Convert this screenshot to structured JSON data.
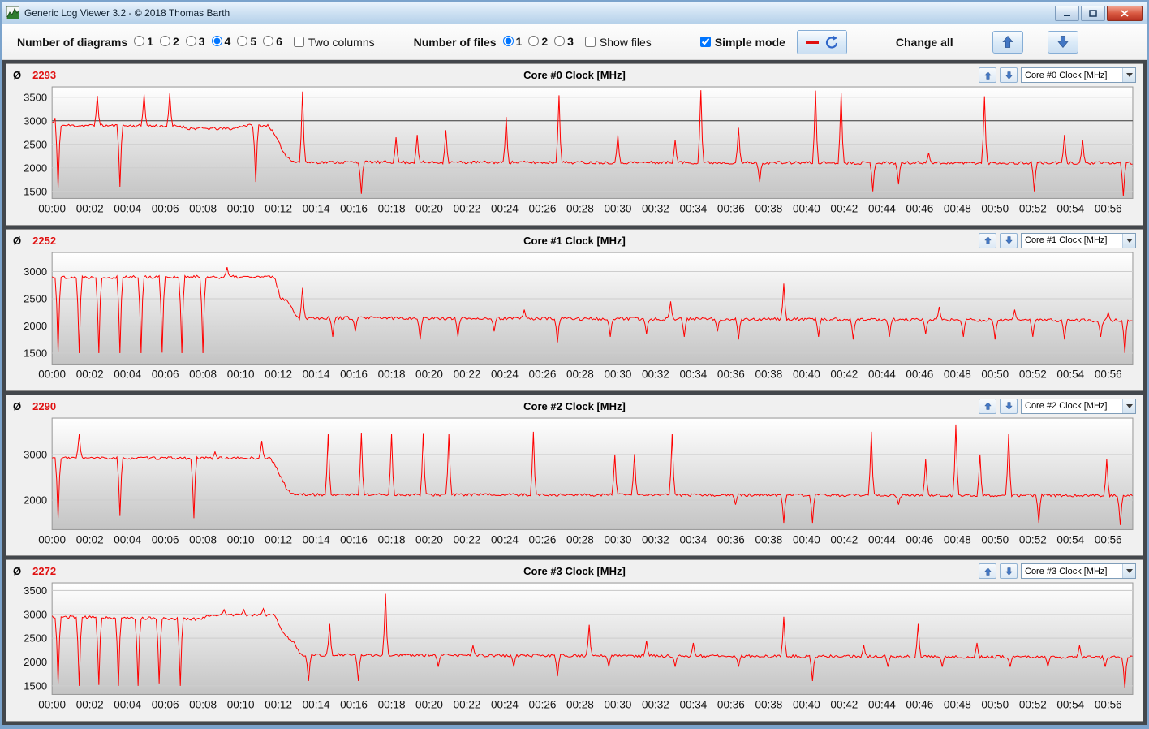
{
  "window": {
    "title": "Generic Log Viewer 3.2 - © 2018 Thomas Barth"
  },
  "toolbar": {
    "diagrams_label": "Number of diagrams",
    "diagram_options": [
      "1",
      "2",
      "3",
      "4",
      "5",
      "6"
    ],
    "diagrams_selected": "4",
    "two_columns_label": "Two columns",
    "two_columns_checked": false,
    "files_label": "Number of files",
    "file_options": [
      "1",
      "2",
      "3"
    ],
    "files_selected": "1",
    "show_files_label": "Show files",
    "show_files_checked": false,
    "simple_mode_label": "Simple mode",
    "simple_mode_checked": true,
    "change_all_label": "Change all"
  },
  "panel_chrome": {
    "avg_symbol": "Ø"
  },
  "chart_data": [
    {
      "type": "line",
      "title": "Core #0 Clock [MHz]",
      "average": 2293,
      "color": "#ff0000",
      "x_range": [
        0,
        57.3
      ],
      "ylim": [
        1350,
        3720
      ],
      "yticks": [
        1500,
        2000,
        2500,
        3000,
        3500
      ],
      "emphasis_line": 3000,
      "xticks": {
        "minutes": [
          0,
          2,
          4,
          6,
          8,
          10,
          12,
          14,
          16,
          18,
          20,
          22,
          24,
          26,
          28,
          30,
          32,
          34,
          36,
          38,
          40,
          42,
          44,
          46,
          48,
          50,
          52,
          54,
          56
        ],
        "labels": [
          "00:00",
          "00:02",
          "00:04",
          "00:06",
          "00:08",
          "00:10",
          "00:12",
          "00:14",
          "00:16",
          "00:18",
          "00:20",
          "00:22",
          "00:24",
          "00:26",
          "00:28",
          "00:30",
          "00:32",
          "00:34",
          "00:36",
          "00:38",
          "00:40",
          "00:42",
          "00:44",
          "00:46",
          "00:48",
          "00:50",
          "00:52",
          "00:54",
          "00:56"
        ]
      },
      "baseline": [
        [
          0,
          2950
        ],
        [
          0.6,
          2900
        ],
        [
          6.8,
          2890
        ],
        [
          7.2,
          2840
        ],
        [
          9.6,
          2830
        ],
        [
          10.1,
          2900
        ],
        [
          11.5,
          2900
        ],
        [
          11.9,
          2620
        ],
        [
          12.4,
          2250
        ],
        [
          12.9,
          2120
        ],
        [
          57.3,
          2100
        ]
      ],
      "noise": 32,
      "seed": 11,
      "spikes": [
        [
          0.15,
          3060
        ],
        [
          2.4,
          3530
        ],
        [
          4.9,
          3560
        ],
        [
          6.2,
          3580
        ],
        [
          13.3,
          3620
        ],
        [
          18.2,
          2650
        ],
        [
          19.4,
          2700
        ],
        [
          20.9,
          2800
        ],
        [
          24.1,
          3080
        ],
        [
          26.9,
          3540
        ],
        [
          30.0,
          2700
        ],
        [
          33.0,
          2600
        ],
        [
          34.4,
          3650
        ],
        [
          36.4,
          2850
        ],
        [
          40.5,
          3640
        ],
        [
          41.8,
          3600
        ],
        [
          46.5,
          2320
        ],
        [
          49.4,
          3520
        ],
        [
          53.7,
          2700
        ],
        [
          54.6,
          2600
        ]
      ],
      "dips": [
        [
          0.35,
          1580
        ],
        [
          3.6,
          1600
        ],
        [
          10.8,
          1700
        ],
        [
          16.4,
          1450
        ],
        [
          37.5,
          1700
        ],
        [
          43.5,
          1500
        ],
        [
          44.9,
          1650
        ],
        [
          52.1,
          1500
        ],
        [
          56.8,
          1400
        ]
      ]
    },
    {
      "type": "line",
      "title": "Core #1 Clock [MHz]",
      "average": 2252,
      "color": "#ff0000",
      "x_range": [
        0,
        57.3
      ],
      "ylim": [
        1300,
        3350
      ],
      "yticks": [
        1500,
        2000,
        2500,
        3000
      ],
      "xticks": {
        "minutes": [
          0,
          2,
          4,
          6,
          8,
          10,
          12,
          14,
          16,
          18,
          20,
          22,
          24,
          26,
          28,
          30,
          32,
          34,
          36,
          38,
          40,
          42,
          44,
          46,
          48,
          50,
          52,
          54,
          56
        ],
        "labels": [
          "00:00",
          "00:02",
          "00:04",
          "00:06",
          "00:08",
          "00:10",
          "00:12",
          "00:14",
          "00:16",
          "00:18",
          "00:20",
          "00:22",
          "00:24",
          "00:26",
          "00:28",
          "00:30",
          "00:32",
          "00:34",
          "00:36",
          "00:38",
          "00:40",
          "00:42",
          "00:44",
          "00:46",
          "00:48",
          "00:50",
          "00:52",
          "00:54",
          "00:56"
        ]
      },
      "baseline": [
        [
          0,
          2900
        ],
        [
          11.8,
          2900
        ],
        [
          12.1,
          2520
        ],
        [
          12.6,
          2430
        ],
        [
          13.0,
          2150
        ],
        [
          57.3,
          2100
        ]
      ],
      "noise": 30,
      "seed": 22,
      "spikes": [
        [
          9.3,
          3080
        ],
        [
          13.3,
          2700
        ],
        [
          25.0,
          2300
        ],
        [
          32.8,
          2450
        ],
        [
          38.8,
          2780
        ],
        [
          47.0,
          2350
        ],
        [
          51.0,
          2300
        ],
        [
          56.0,
          2250
        ]
      ],
      "dips": [
        [
          0.3,
          1520
        ],
        [
          1.4,
          1500
        ],
        [
          2.5,
          1500
        ],
        [
          3.6,
          1500
        ],
        [
          4.7,
          1500
        ],
        [
          5.8,
          1510
        ],
        [
          6.9,
          1500
        ],
        [
          8.0,
          1500
        ],
        [
          14.9,
          1800
        ],
        [
          16.1,
          1900
        ],
        [
          19.5,
          1750
        ],
        [
          21.5,
          1800
        ],
        [
          23.4,
          1900
        ],
        [
          26.8,
          1700
        ],
        [
          29.6,
          1800
        ],
        [
          31.5,
          1850
        ],
        [
          33.5,
          1800
        ],
        [
          35.3,
          1900
        ],
        [
          36.4,
          1750
        ],
        [
          40.6,
          1800
        ],
        [
          42.5,
          1750
        ],
        [
          44.4,
          1800
        ],
        [
          46.3,
          1850
        ],
        [
          48.3,
          1800
        ],
        [
          50.0,
          1750
        ],
        [
          52.0,
          1800
        ],
        [
          53.7,
          1750
        ],
        [
          55.6,
          1800
        ],
        [
          56.9,
          1500
        ]
      ]
    },
    {
      "type": "line",
      "title": "Core #2 Clock [MHz]",
      "average": 2290,
      "color": "#ff0000",
      "x_range": [
        0,
        57.3
      ],
      "ylim": [
        1350,
        3800
      ],
      "yticks": [
        2000,
        3000
      ],
      "xticks": {
        "minutes": [
          0,
          2,
          4,
          6,
          8,
          10,
          12,
          14,
          16,
          18,
          20,
          22,
          24,
          26,
          28,
          30,
          32,
          34,
          36,
          38,
          40,
          42,
          44,
          46,
          48,
          50,
          52,
          54,
          56
        ],
        "labels": [
          "00:00",
          "00:02",
          "00:04",
          "00:06",
          "00:08",
          "00:10",
          "00:12",
          "00:14",
          "00:16",
          "00:18",
          "00:20",
          "00:22",
          "00:24",
          "00:26",
          "00:28",
          "00:30",
          "00:32",
          "00:34",
          "00:36",
          "00:38",
          "00:40",
          "00:42",
          "00:44",
          "00:46",
          "00:48",
          "00:50",
          "00:52",
          "00:54",
          "00:56"
        ]
      },
      "baseline": [
        [
          0,
          2920
        ],
        [
          11.6,
          2920
        ],
        [
          12.0,
          2620
        ],
        [
          12.5,
          2200
        ],
        [
          12.9,
          2120
        ],
        [
          57.3,
          2100
        ]
      ],
      "noise": 30,
      "seed": 33,
      "spikes": [
        [
          1.4,
          3450
        ],
        [
          8.6,
          3060
        ],
        [
          11.1,
          3300
        ],
        [
          14.6,
          3450
        ],
        [
          16.4,
          3480
        ],
        [
          18.0,
          3460
        ],
        [
          19.7,
          3470
        ],
        [
          21.0,
          3450
        ],
        [
          25.5,
          3500
        ],
        [
          29.8,
          3000
        ],
        [
          30.9,
          3010
        ],
        [
          32.9,
          3460
        ],
        [
          43.4,
          3500
        ],
        [
          46.3,
          2900
        ],
        [
          47.9,
          3660
        ],
        [
          49.2,
          3000
        ],
        [
          50.7,
          3450
        ],
        [
          55.9,
          2900
        ]
      ],
      "dips": [
        [
          0.3,
          1600
        ],
        [
          3.6,
          1650
        ],
        [
          7.5,
          1600
        ],
        [
          36.2,
          1900
        ],
        [
          38.8,
          1500
        ],
        [
          40.3,
          1500
        ],
        [
          44.9,
          1900
        ],
        [
          52.3,
          1500
        ],
        [
          56.6,
          1450
        ]
      ]
    },
    {
      "type": "line",
      "title": "Core #3 Clock [MHz]",
      "average": 2272,
      "color": "#ff0000",
      "x_range": [
        0,
        57.3
      ],
      "ylim": [
        1320,
        3660
      ],
      "yticks": [
        1500,
        2000,
        2500,
        3000,
        3500
      ],
      "xticks": {
        "minutes": [
          0,
          2,
          4,
          6,
          8,
          10,
          12,
          14,
          16,
          18,
          20,
          22,
          24,
          26,
          28,
          30,
          32,
          34,
          36,
          38,
          40,
          42,
          44,
          46,
          48,
          50,
          52,
          54,
          56
        ],
        "labels": [
          "00:00",
          "00:02",
          "00:04",
          "00:06",
          "00:08",
          "00:10",
          "00:12",
          "00:14",
          "00:16",
          "00:18",
          "00:20",
          "00:22",
          "00:24",
          "00:26",
          "00:28",
          "00:30",
          "00:32",
          "00:34",
          "00:36",
          "00:38",
          "00:40",
          "00:42",
          "00:44",
          "00:46",
          "00:48",
          "00:50",
          "00:52",
          "00:54",
          "00:56"
        ]
      },
      "baseline": [
        [
          0,
          2950
        ],
        [
          7.8,
          2900
        ],
        [
          8.4,
          2990
        ],
        [
          11.8,
          2990
        ],
        [
          12.2,
          2620
        ],
        [
          12.8,
          2420
        ],
        [
          13.2,
          2150
        ],
        [
          57.3,
          2100
        ]
      ],
      "noise": 30,
      "seed": 44,
      "spikes": [
        [
          9.1,
          3100
        ],
        [
          10.2,
          3100
        ],
        [
          11.2,
          3120
        ],
        [
          14.7,
          2800
        ],
        [
          17.7,
          3430
        ],
        [
          22.3,
          2350
        ],
        [
          28.5,
          2780
        ],
        [
          31.5,
          2450
        ],
        [
          34.0,
          2400
        ],
        [
          38.8,
          2950
        ],
        [
          43.0,
          2350
        ],
        [
          45.9,
          2800
        ],
        [
          49.0,
          2400
        ],
        [
          54.5,
          2350
        ]
      ],
      "dips": [
        [
          0.3,
          1550
        ],
        [
          1.4,
          1500
        ],
        [
          2.5,
          1520
        ],
        [
          3.5,
          1500
        ],
        [
          4.6,
          1500
        ],
        [
          5.7,
          1550
        ],
        [
          6.8,
          1500
        ],
        [
          13.6,
          1600
        ],
        [
          16.2,
          1600
        ],
        [
          20.5,
          1900
        ],
        [
          24.5,
          1900
        ],
        [
          26.8,
          1700
        ],
        [
          29.5,
          1900
        ],
        [
          33.0,
          1900
        ],
        [
          36.4,
          1900
        ],
        [
          40.3,
          1600
        ],
        [
          44.3,
          1900
        ],
        [
          47.2,
          1900
        ],
        [
          50.8,
          1900
        ],
        [
          52.8,
          1900
        ],
        [
          55.8,
          1900
        ],
        [
          56.9,
          1450
        ]
      ]
    }
  ]
}
